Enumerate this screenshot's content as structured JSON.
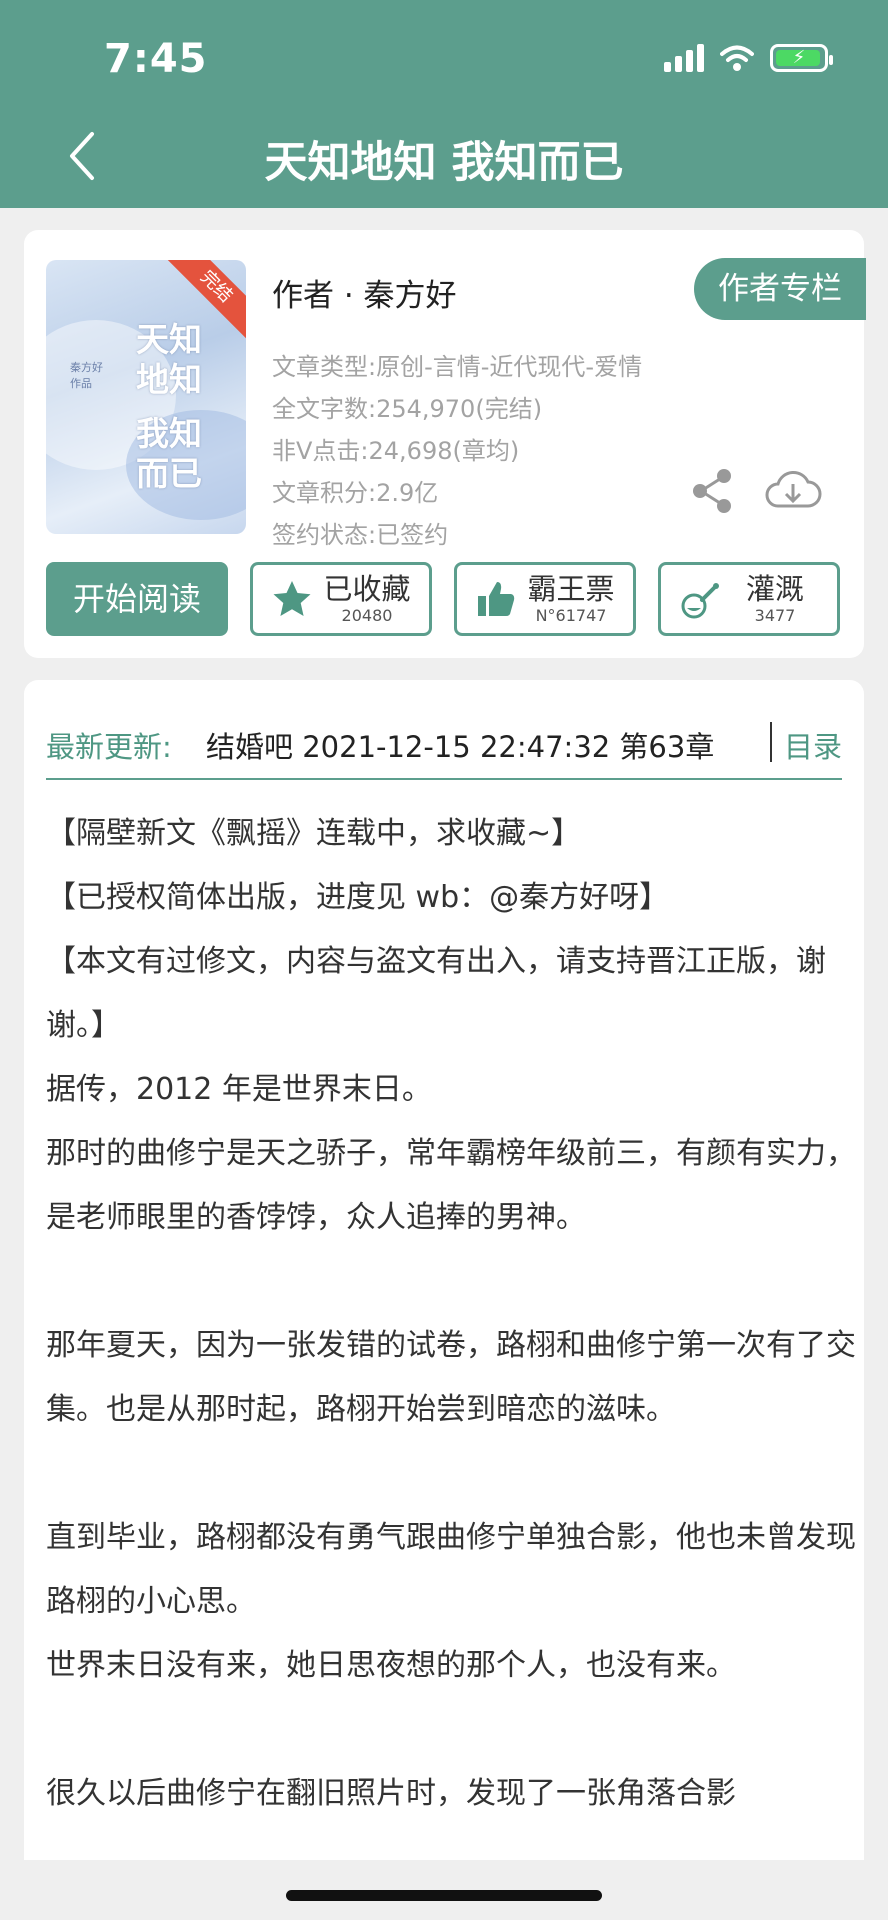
{
  "status_bar": {
    "time": "7:45"
  },
  "header": {
    "title": "天知地知 我知而已"
  },
  "book": {
    "cover": {
      "title_lines": [
        "天知",
        "地知",
        "我知",
        "而已"
      ],
      "ribbon": "完结",
      "author_small": "秦方好作品"
    },
    "author_line": "作者 · 秦方好",
    "author_page_button": "作者专栏",
    "meta": [
      "文章类型:原创-言情-近代现代-爱情",
      "全文字数:254,970(完结)",
      "非V点击:24,698(章均)",
      "文章积分:2.9亿",
      "签约状态:已签约"
    ],
    "actions": {
      "start_reading": "开始阅读",
      "collect": {
        "label": "已收藏",
        "count": "20480"
      },
      "vote": {
        "label": "霸王票",
        "count": "N°61747"
      },
      "water": {
        "label": "灌溉",
        "count": "3477"
      }
    }
  },
  "update": {
    "label": "最新更新:",
    "text": "结婚吧 2021-12-15 22:47:32 第63章",
    "toc": "目录"
  },
  "intro": [
    "【隔壁新文《飘摇》连载中，求收藏~】",
    "【已授权简体出版，进度见 wb：@秦方好呀】",
    "【本文有过修文，内容与盗文有出入，请支持晋江正版，谢谢。】",
    "据传，2012 年是世界末日。",
    "那时的曲修宁是天之骄子，常年霸榜年级前三，有颜有实力，是老师眼里的香饽饽，众人追捧的男神。",
    "",
    "那年夏天，因为一张发错的试卷，路栩和曲修宁第一次有了交集。也是从那时起，路栩开始尝到暗恋的滋味。",
    "",
    "直到毕业，路栩都没有勇气跟曲修宁单独合影，他也未曾发现路栩的小心思。",
    "世界末日没有来，她日思夜想的那个人，也没有来。",
    "",
    "很久以后曲修宁在翻旧照片时，发现了一张角落合影"
  ],
  "colors": {
    "accent": "#5c9e8d",
    "ribbon": "#e4533d"
  }
}
